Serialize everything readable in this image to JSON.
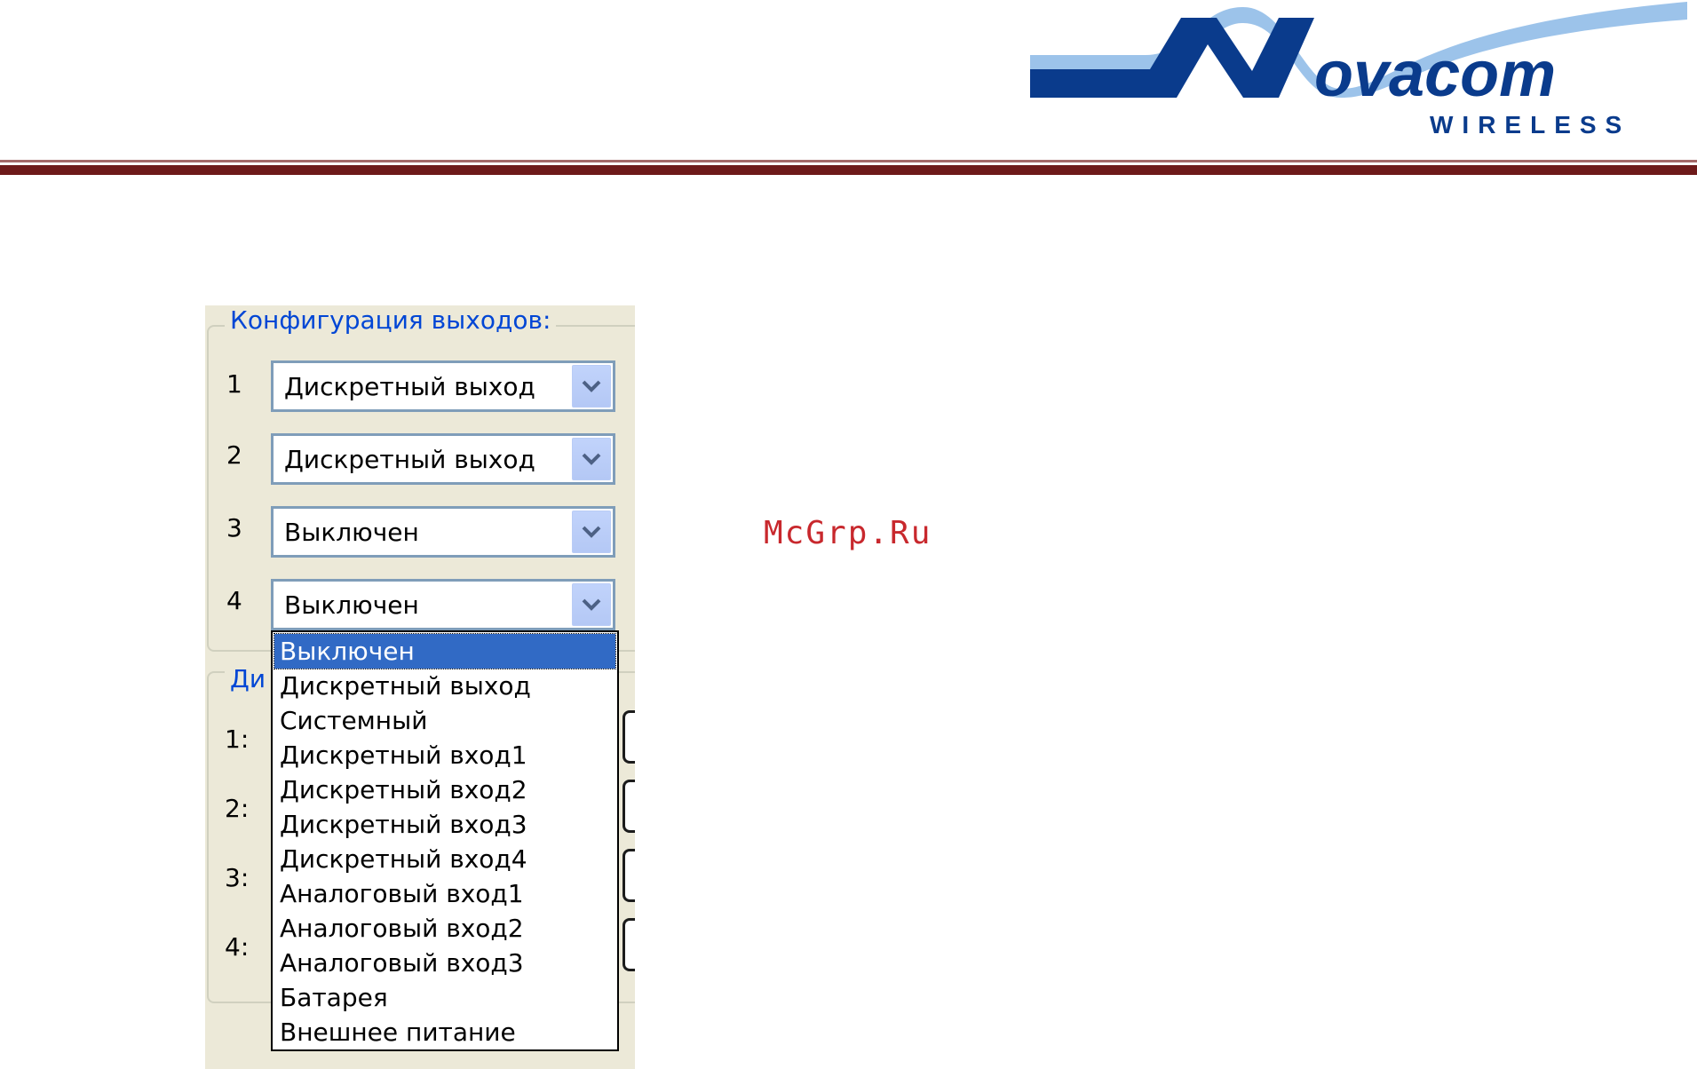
{
  "branding": {
    "logo_name": "Novacom",
    "logo_sub": "WIRELESS",
    "colors": {
      "navy": "#0a3b8c",
      "sky": "#9cc3ea",
      "rule_dark": "#6e1a1a",
      "rule_light": "#a46868"
    }
  },
  "watermark": "McGrp.Ru",
  "outputs_group": {
    "legend": "Конфигурация выходов:",
    "rows": [
      {
        "num": "1",
        "value": "Дискретный выход"
      },
      {
        "num": "2",
        "value": "Дискретный выход"
      },
      {
        "num": "3",
        "value": "Выключен"
      },
      {
        "num": "4",
        "value": "Выключен"
      }
    ]
  },
  "inputs_group": {
    "legend_partial": "Ди",
    "rows": [
      "1:",
      "2:",
      "3:",
      "4:"
    ]
  },
  "dropdown": {
    "selected": "Выключен",
    "options": [
      "Выключен",
      "Дискретный выход",
      "Системный",
      "Дискретный вход1",
      "Дискретный вход2",
      "Дискретный вход3",
      "Дискретный вход4",
      "Аналоговый вход1",
      "Аналоговый вход2",
      "Аналоговый вход3",
      "Батарея",
      "Внешнее питание"
    ]
  }
}
